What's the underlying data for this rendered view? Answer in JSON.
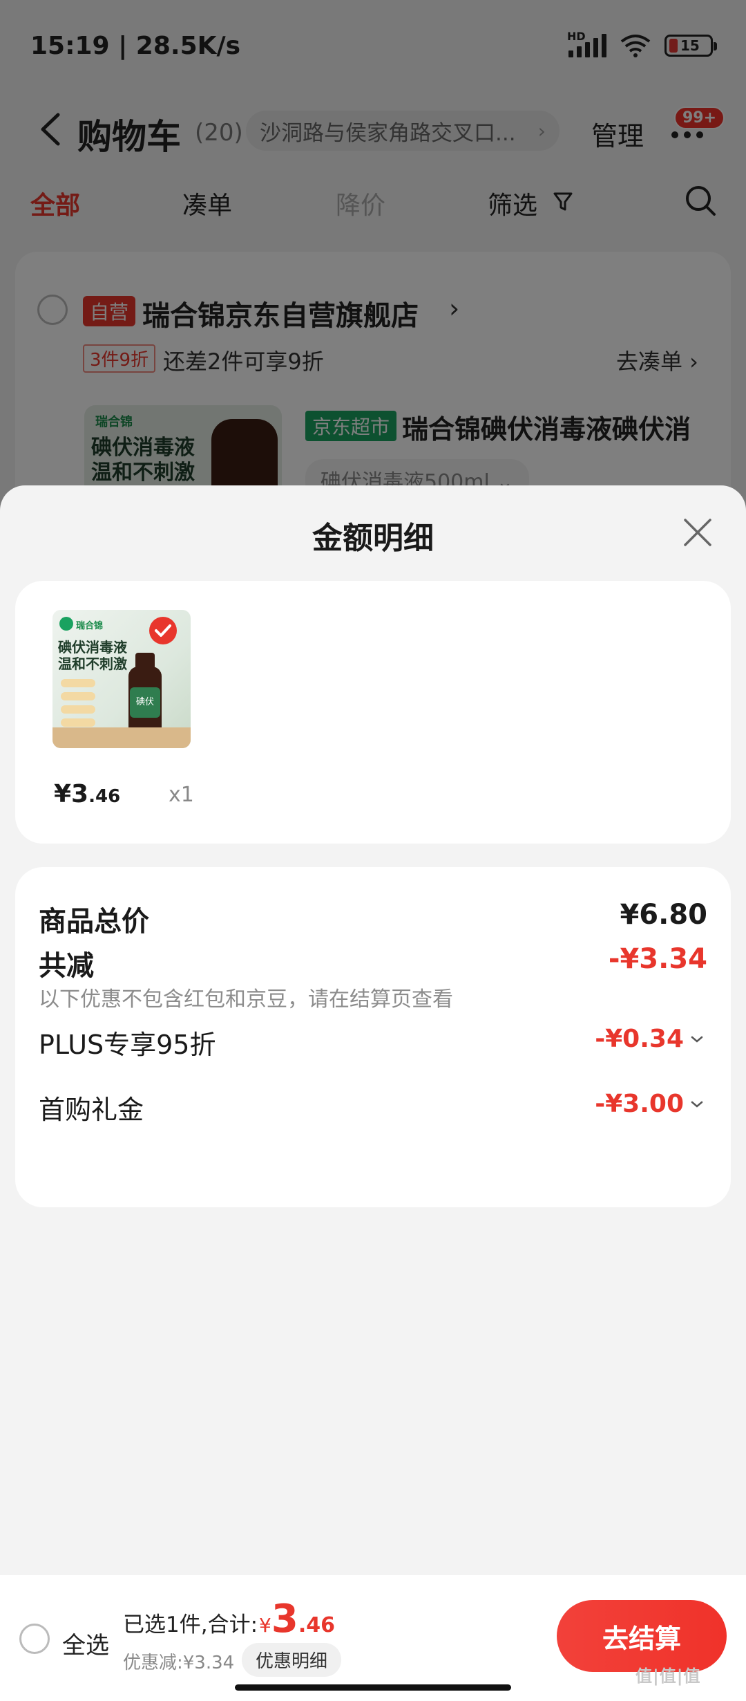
{
  "status_bar": {
    "time": "15:19 | 28.5K/s",
    "battery_level": "15",
    "network": "HD"
  },
  "header": {
    "title": "购物车",
    "count": "(20)",
    "address": "沙洞路与侯家角路交叉口...",
    "manage": "管理",
    "badge": "99+"
  },
  "tabs": [
    {
      "label": "全部",
      "state": "active"
    },
    {
      "label": "凑单",
      "state": "normal"
    },
    {
      "label": "降价",
      "state": "muted"
    },
    {
      "label": "筛选",
      "state": "normal"
    }
  ],
  "store": {
    "self_badge": "自营",
    "name": "瑞合锦京东自营旗舰店",
    "promo_tag": "3件9折",
    "promo_text": "还差2件可享9折",
    "promo_link": "去凑单 ›",
    "supermarket_tag": "京东超市",
    "product_name": "瑞合锦碘伏消毒液碘伏消",
    "variant": "碘伏消毒液500ml ⌄",
    "thumb_text_line1": "碘伏消毒液",
    "thumb_text_line2": "温和不刺激",
    "thumb_brand": "瑞合锦"
  },
  "sheet": {
    "title": "金额明细",
    "item": {
      "price_main": "¥3",
      "price_decimal": ".46",
      "qty": "x1",
      "thumb_text_line1": "碘伏消毒液",
      "thumb_text_line2": "温和不刺激",
      "thumb_brand": "瑞合锦",
      "bottle_label": "碘伏"
    },
    "summary": {
      "total_label": "商品总价",
      "total_value": "¥6.80",
      "reduce_label": "共减",
      "reduce_value": "-¥3.34",
      "reduce_note": "以下优惠不包含红包和京豆，请在结算页查看",
      "plus_label": "PLUS专享95折",
      "plus_value": "-¥0.34",
      "gift_label": "首购礼金",
      "gift_value": "-¥3.00"
    }
  },
  "bottom_bar": {
    "select_all": "全选",
    "summary_prefix": "已选1件,合计:",
    "yen": "¥",
    "total_int": "3",
    "total_dec": ".46",
    "discount_text": "优惠减:¥3.34",
    "detail_button": "优惠明细",
    "checkout": "去结算"
  },
  "watermark": "值|值|值",
  "colors": {
    "accent_red": "#e8362c",
    "supermarket_green": "#1aa260",
    "sheet_bg": "#f3f3f3"
  },
  "icons": [
    "back-icon",
    "chevron-right-icon",
    "more-dots-icon",
    "filter-icon",
    "search-icon",
    "close-icon",
    "chevron-down-icon",
    "checkmark-icon"
  ]
}
